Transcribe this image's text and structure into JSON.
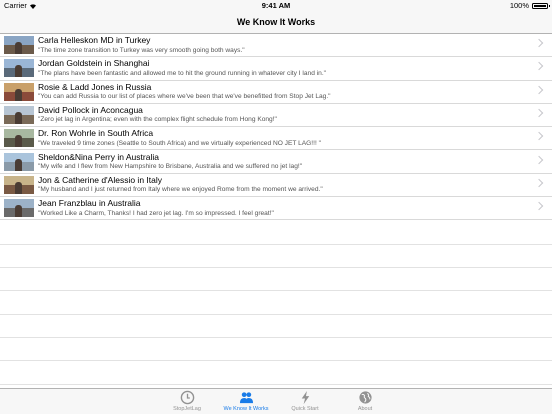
{
  "status_bar": {
    "carrier": "Carrier",
    "time": "9:41 AM",
    "battery": "100%"
  },
  "nav": {
    "title": "We Know It Works"
  },
  "rows": [
    {
      "title": "Carla Helleskon MD in Turkey",
      "quote": "\"The time zone transition to Turkey was very smooth going both ways.\"",
      "thumb": {
        "sky": "#8aa5c4",
        "ground": "#6b5a4a"
      }
    },
    {
      "title": "Jordan Goldstein in Shanghai",
      "quote": "\"The plans have been fantastic and allowed me to hit the ground running in whatever city I land in.\"",
      "thumb": {
        "sky": "#9ab6d6",
        "ground": "#5a6a7a"
      }
    },
    {
      "title": "Rosie & Ladd Jones in Russia",
      "quote": "\"You can add Russia to our list of places where we've been that we've benefitted from Stop Jet Lag.\"",
      "thumb": {
        "sky": "#c9a06a",
        "ground": "#8a4a3a"
      }
    },
    {
      "title": "David Pollock in Aconcagua",
      "quote": "\"Zero jet lag in Argentina; even with the complex flight schedule from Hong Kong!\"",
      "thumb": {
        "sky": "#b8c6d4",
        "ground": "#7a6a58"
      }
    },
    {
      "title": "Dr. Ron Wohrle in South Africa",
      "quote": "\"We traveled 9 time zones  (Seattle to South Africa) and we virtually experienced NO JET LAG!!! \"",
      "thumb": {
        "sky": "#a8b8a0",
        "ground": "#5a5a4a"
      }
    },
    {
      "title": "Sheldon&Nina Perry in Australia",
      "quote": "\"My wife and I flew from New Hampshire to Brisbane, Australia and we suffered no jet lag!\"",
      "thumb": {
        "sky": "#aac4dc",
        "ground": "#8a9aa8"
      }
    },
    {
      "title": "Jon & Catherine d'Alessio in Italy",
      "quote": "\"My husband and I just returned from Italy where we enjoyed Rome from the moment we arrived.\"",
      "thumb": {
        "sky": "#c8b48a",
        "ground": "#7a5a44"
      }
    },
    {
      "title": "Jean Franzblau in Australia",
      "quote": "\"Worked Like a Charm, Thanks! I had zero jet lag. I'm so impressed. I feel great!\"",
      "thumb": {
        "sky": "#9cb2c8",
        "ground": "#6a6a6a"
      }
    }
  ],
  "tabs": [
    {
      "label": "StopJetLag",
      "icon": "clock-icon"
    },
    {
      "label": "We Know It Works",
      "icon": "people-icon",
      "active": true
    },
    {
      "label": "Quick Start",
      "icon": "lightning-icon"
    },
    {
      "label": "About",
      "icon": "globe-icon"
    }
  ],
  "colors": {
    "accent": "#1a7ce8",
    "inactive": "#929292"
  }
}
